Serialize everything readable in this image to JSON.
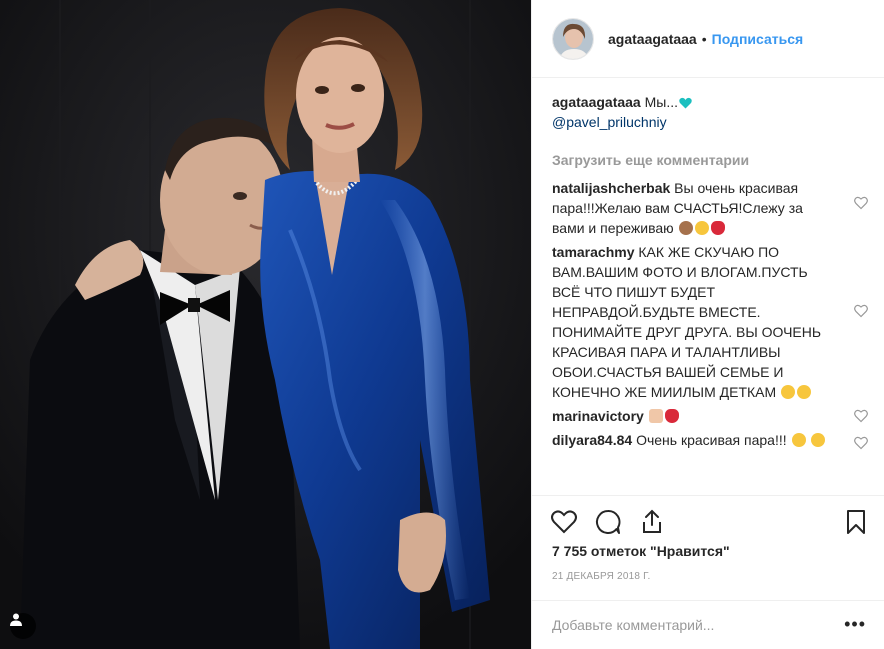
{
  "post": {
    "author": "agataagataaa",
    "follow_label": "Подписаться",
    "caption_text": "Мы...",
    "caption_mention": "@pavel_priluchniy",
    "load_more": "Загрузить еще комментарии",
    "comments": [
      {
        "user": "natalijashcherbak",
        "text": "Вы очень красивая пара!!!Желаю вам СЧАСТЬЯ!Слежу за вами и переживаю"
      },
      {
        "user": "tamarachmy",
        "text": "КАК ЖЕ СКУЧАЮ ПО ВАМ.ВАШИМ ФОТО И ВЛОГАМ.ПУСТЬ ВСЁ ЧТО ПИШУТ БУДЕТ НЕПРАВДОЙ.БУДЬТЕ ВМЕСТЕ. ПОНИМАЙТЕ ДРУГ ДРУГА. ВЫ ООЧЕНЬ КРАСИВАЯ ПАРА И ТАЛАНТЛИВЫ ОБОИ.СЧАСТЬЯ ВАШЕЙ СЕМЬЕ И КОНЕЧНО ЖЕ МИИЛЫМ ДЕТКАМ"
      },
      {
        "user": "marinavictory",
        "text": ""
      },
      {
        "user": "dilyara84.84",
        "text": "Очень красивая пара!!!"
      }
    ],
    "likes": "7 755 отметок \"Нравится\"",
    "date": "21 ДЕКАБРЯ 2018 Г.",
    "add_comment_placeholder": "Добавьте комментарий...",
    "more_label": "•••"
  },
  "icons": {
    "like": "heart-icon",
    "comment": "comment-bubble-icon",
    "share": "share-icon",
    "save": "bookmark-icon",
    "user_tags": "person-icon"
  },
  "colors": {
    "link": "#3897f0",
    "mention": "#003569",
    "muted": "#999999",
    "text": "#262626",
    "border": "#efefef"
  }
}
